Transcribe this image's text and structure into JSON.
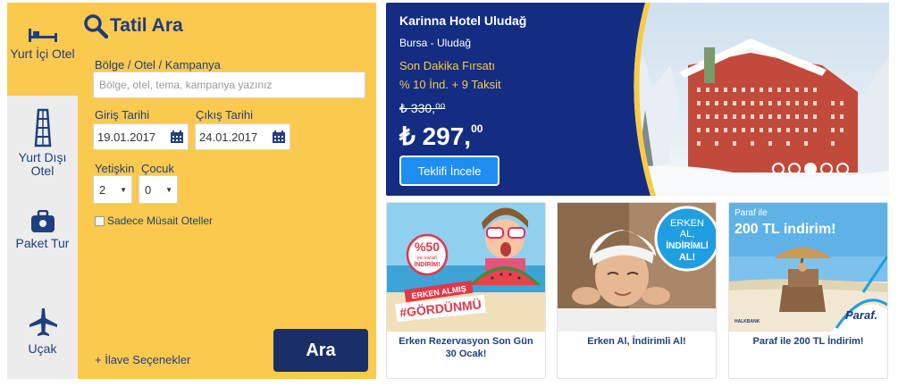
{
  "tabs": [
    {
      "label": "Yurt İçi Otel",
      "icon": "bed-icon"
    },
    {
      "label": "Yurt Dışı Otel",
      "icon": "tower-icon"
    },
    {
      "label": "Paket Tur",
      "icon": "suitcase-icon"
    },
    {
      "label": "Uçak",
      "icon": "airplane-icon"
    }
  ],
  "search": {
    "title": "Tatil Ara",
    "region_label": "Bölge / Otel / Kampanya",
    "region_placeholder": "Bölge, otel, tema, kampanya yazınız",
    "checkin_label": "Giriş Tarihi",
    "checkin_value": "19.01.2017",
    "checkout_label": "Çıkış Tarihi",
    "checkout_value": "24.01.2017",
    "adult_label": "Yetişkin",
    "child_label": "Çocuk",
    "adult_value": "2",
    "child_value": "0",
    "available_only": "Sadece Müsait Oteller",
    "more_options": "+ İlave Seçenekler",
    "submit": "Ara"
  },
  "hero": {
    "title": "Karinna Hotel Uludağ",
    "location": "Bursa - Uludağ",
    "deal_line1": "Son Dakika Fırsatı",
    "deal_line2": "% 10 İnd. + 9 Taksit",
    "old_price": "₺ 330,⁰⁰",
    "price_main": "₺ 297,",
    "price_cents": "00",
    "button": "Teklifi İncele",
    "slide_count": 5,
    "active_slide": 3
  },
  "cards": [
    {
      "caption": "Erken Rezervasyon Son Gün 30 Ocak!",
      "badge1": "%50",
      "badge2": "ye varan",
      "badge3": "İNDİRİM!",
      "banner1": "ERKEN ALMIŞ",
      "banner2": "#GÖRDÜNMÜ"
    },
    {
      "caption": "Erken Al, İndirimli Al!",
      "badge1": "ERKEN",
      "badge2": "AL,",
      "badge3": "İNDİRİMLİ",
      "badge4": "AL!"
    },
    {
      "caption": "Paraf ile 200 TL İndirim!",
      "line1": "Paraf ile",
      "line2": "200 TL indirim!",
      "brand": "Paraf.",
      "bank": "HALKBANK"
    }
  ],
  "colors": {
    "accent": "#fcc94f",
    "navy": "#142d83",
    "button": "#1a2f66",
    "link": "#1f3f80",
    "cta": "#1f8ef0"
  }
}
